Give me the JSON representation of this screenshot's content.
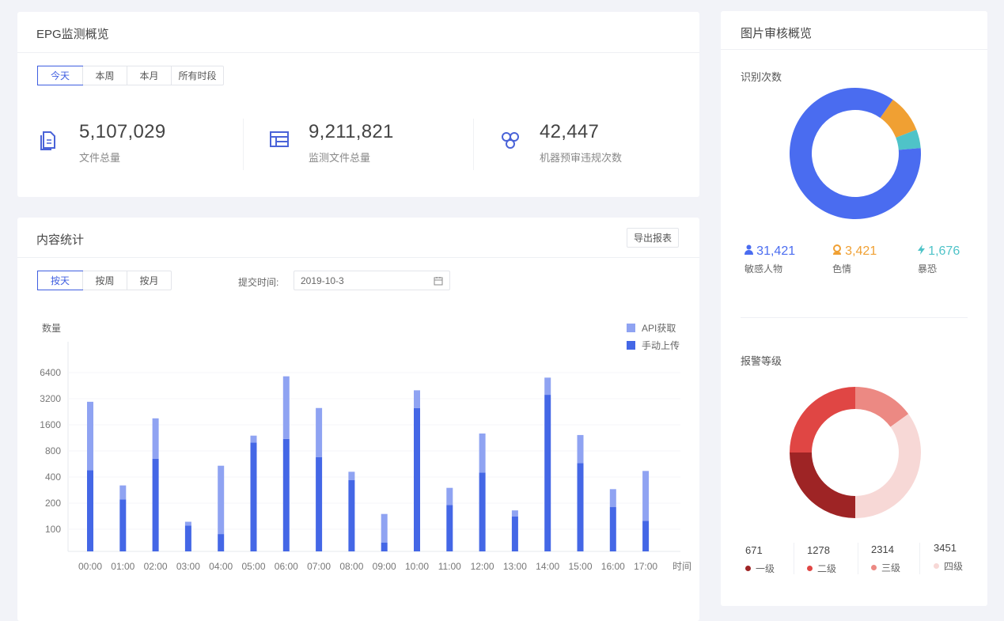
{
  "epg": {
    "title": "EPG监测概览",
    "tabs": [
      "今天",
      "本周",
      "本月",
      "所有时段"
    ],
    "active_tab": 0,
    "stats": [
      {
        "value": "5,107,029",
        "label": "文件总量",
        "icon": "document-icon"
      },
      {
        "value": "9,211,821",
        "label": "监测文件总量",
        "icon": "table-icon"
      },
      {
        "value": "42,447",
        "label": "机器预审违规次数",
        "icon": "cluster-icon"
      }
    ]
  },
  "content": {
    "title": "内容统计",
    "export_label": "导出报表",
    "tabs": [
      "按天",
      "按周",
      "按月"
    ],
    "active_tab": 0,
    "date_label": "提交时间:",
    "date_value": "2019-10-3",
    "date_icon": "calendar-icon"
  },
  "image_review": {
    "title": "图片审核概览",
    "recognition_title": "识别次数",
    "recognition": [
      {
        "value": "31,421",
        "label": "敏感人物",
        "color": "#4a6cf0",
        "icon": "person-icon"
      },
      {
        "value": "3,421",
        "label": "色情",
        "color": "#f0a033",
        "icon": "female-icon"
      },
      {
        "value": "1,676",
        "label": "暴恐",
        "color": "#4fc3c8",
        "icon": "bolt-icon"
      }
    ],
    "alarm_title": "报警等级",
    "alarm": [
      {
        "value": "671",
        "label": "一级",
        "color": "#9e2425"
      },
      {
        "value": "1278",
        "label": "二级",
        "color": "#e04644"
      },
      {
        "value": "2314",
        "label": "三级",
        "color": "#ec8983"
      },
      {
        "value": "3451",
        "label": "四级",
        "color": "#f7d8d6"
      }
    ]
  },
  "chart_data": [
    {
      "type": "bar",
      "stacked": true,
      "yscale": "log2",
      "ylabel": "数量",
      "xlabel": "时间",
      "categories": [
        "00:00",
        "01:00",
        "02:00",
        "03:00",
        "04:00",
        "05:00",
        "06:00",
        "07:00",
        "08:00",
        "09:00",
        "10:00",
        "11:00",
        "12:00",
        "13:00",
        "14:00",
        "15:00",
        "16:00",
        "17:00"
      ],
      "yticks": [
        100,
        200,
        400,
        800,
        1600,
        3200,
        6400
      ],
      "ylim": [
        55,
        14000
      ],
      "series": [
        {
          "name": "手动上传",
          "color": "#4467e6",
          "values": [
            480,
            220,
            650,
            110,
            88,
            1000,
            1100,
            680,
            370,
            70,
            2500,
            190,
            450,
            140,
            3550,
            580,
            180,
            125
          ]
        },
        {
          "name": "API获取",
          "color": "#8fa3f2",
          "values": [
            2470,
            100,
            1250,
            12,
            452,
            200,
            4700,
            1820,
            90,
            80,
            1500,
            110,
            820,
            25,
            2050,
            640,
            110,
            345
          ]
        }
      ],
      "legend": "top-right"
    },
    {
      "type": "pie",
      "title": "识别次数",
      "labels": [
        "敏感人物",
        "色情",
        "暴恐"
      ],
      "values": [
        31421,
        3421,
        1676
      ]
    },
    {
      "type": "pie",
      "title": "报警等级",
      "labels": [
        "一级",
        "二级",
        "三级",
        "四级"
      ],
      "values": [
        671,
        1278,
        2314,
        3451
      ],
      "visual_share": [
        0.25,
        0.25,
        0.15,
        0.35
      ]
    }
  ]
}
